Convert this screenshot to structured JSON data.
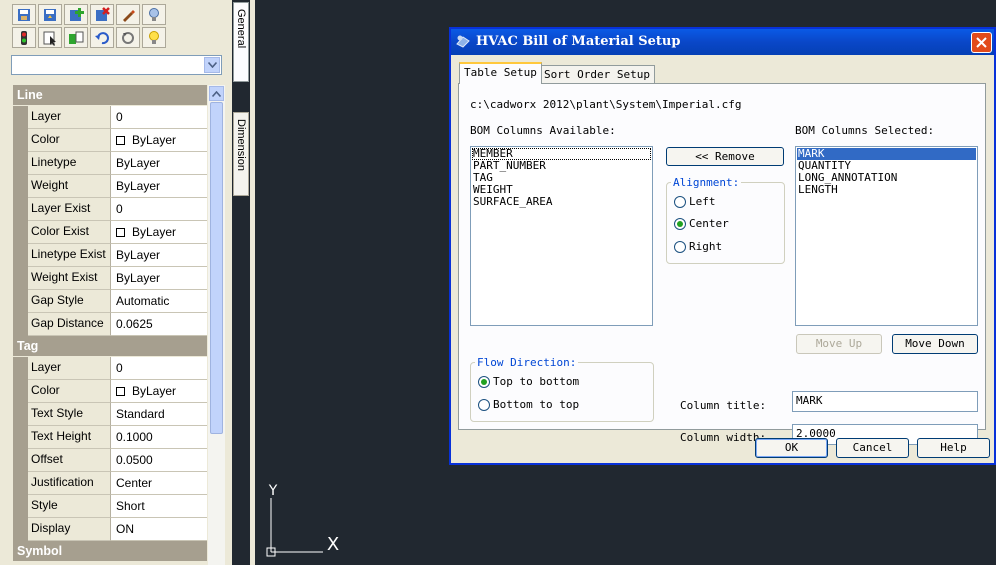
{
  "palette": {
    "tabs": {
      "general": "General",
      "dimension": "Dimension"
    },
    "sections": {
      "line": "Line",
      "tag": "Tag",
      "symbol": "Symbol"
    },
    "line_props": [
      {
        "name": "Layer",
        "value": "0"
      },
      {
        "name": "Color",
        "value": "ByLayer"
      },
      {
        "name": "Linetype",
        "value": "ByLayer"
      },
      {
        "name": "Weight",
        "value": "ByLayer"
      },
      {
        "name": "Layer Exist",
        "value": "0"
      },
      {
        "name": "Color Exist",
        "value": "ByLayer"
      },
      {
        "name": "Linetype Exist",
        "value": "ByLayer"
      },
      {
        "name": "Weight Exist",
        "value": "ByLayer"
      },
      {
        "name": "Gap Style",
        "value": "Automatic"
      },
      {
        "name": "Gap Distance",
        "value": "0.0625"
      }
    ],
    "tag_props": [
      {
        "name": "Layer",
        "value": "0"
      },
      {
        "name": "Color",
        "value": "ByLayer"
      },
      {
        "name": "Text Style",
        "value": "Standard"
      },
      {
        "name": "Text Height",
        "value": "0.1000"
      },
      {
        "name": "Offset",
        "value": "0.0500"
      },
      {
        "name": "Justification",
        "value": "Center"
      },
      {
        "name": "Style",
        "value": "Short"
      },
      {
        "name": "Display",
        "value": "ON"
      }
    ]
  },
  "dialog": {
    "title": "HVAC Bill of Material Setup",
    "tabs": {
      "table_setup": "Table Setup",
      "sort_order": "Sort Order Setup"
    },
    "config_path": "c:\\cadworx 2012\\plant\\System\\Imperial.cfg",
    "available_label": "BOM Columns Available:",
    "available": [
      "MEMBER",
      "PART_NUMBER",
      "TAG",
      "WEIGHT",
      "SURFACE_AREA"
    ],
    "selected_label": "BOM Columns Selected:",
    "selected": [
      "MARK",
      "QUANTITY",
      "LONG_ANNOTATION",
      "LENGTH"
    ],
    "remove_button": "<< Remove",
    "alignment": {
      "label": "Alignment:",
      "left": "Left",
      "center": "Center",
      "right": "Right"
    },
    "move_up": "Move Up",
    "move_down": "Move Down",
    "flow": {
      "label": "Flow Direction:",
      "top_to_bottom": "Top to bottom",
      "bottom_to_top": "Bottom to top"
    },
    "column_title_label": "Column title:",
    "column_title_value": "MARK",
    "column_width_label": "Column width:",
    "column_width_value": "2.0000",
    "ok": "OK",
    "cancel": "Cancel",
    "help": "Help"
  },
  "ucs": {
    "y_label": "Y",
    "x_marker": "X"
  },
  "colors": {
    "title_bar": "#0a47c8",
    "selection": "#316ac5",
    "legend": "#0046d5",
    "canvas": "#212830",
    "section_header": "#a69f8f"
  }
}
